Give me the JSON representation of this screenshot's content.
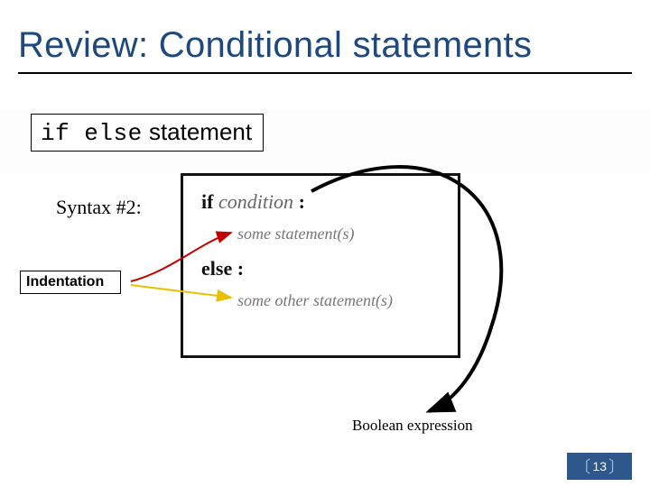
{
  "title": "Review: Conditional statements",
  "subheading": {
    "keyword": "if else",
    "rest": " statement"
  },
  "syntax_label": "Syntax #2:",
  "indentation_label": "Indentation",
  "boolean_label": "Boolean expression",
  "page_number": "13",
  "code": {
    "line1_kw": "if ",
    "line1_cond": "condition",
    "line1_colon": " :",
    "line2": "some statement(s)",
    "line3_kw": "else",
    "line3_colon": " :",
    "line4": "some other statement(s)"
  }
}
